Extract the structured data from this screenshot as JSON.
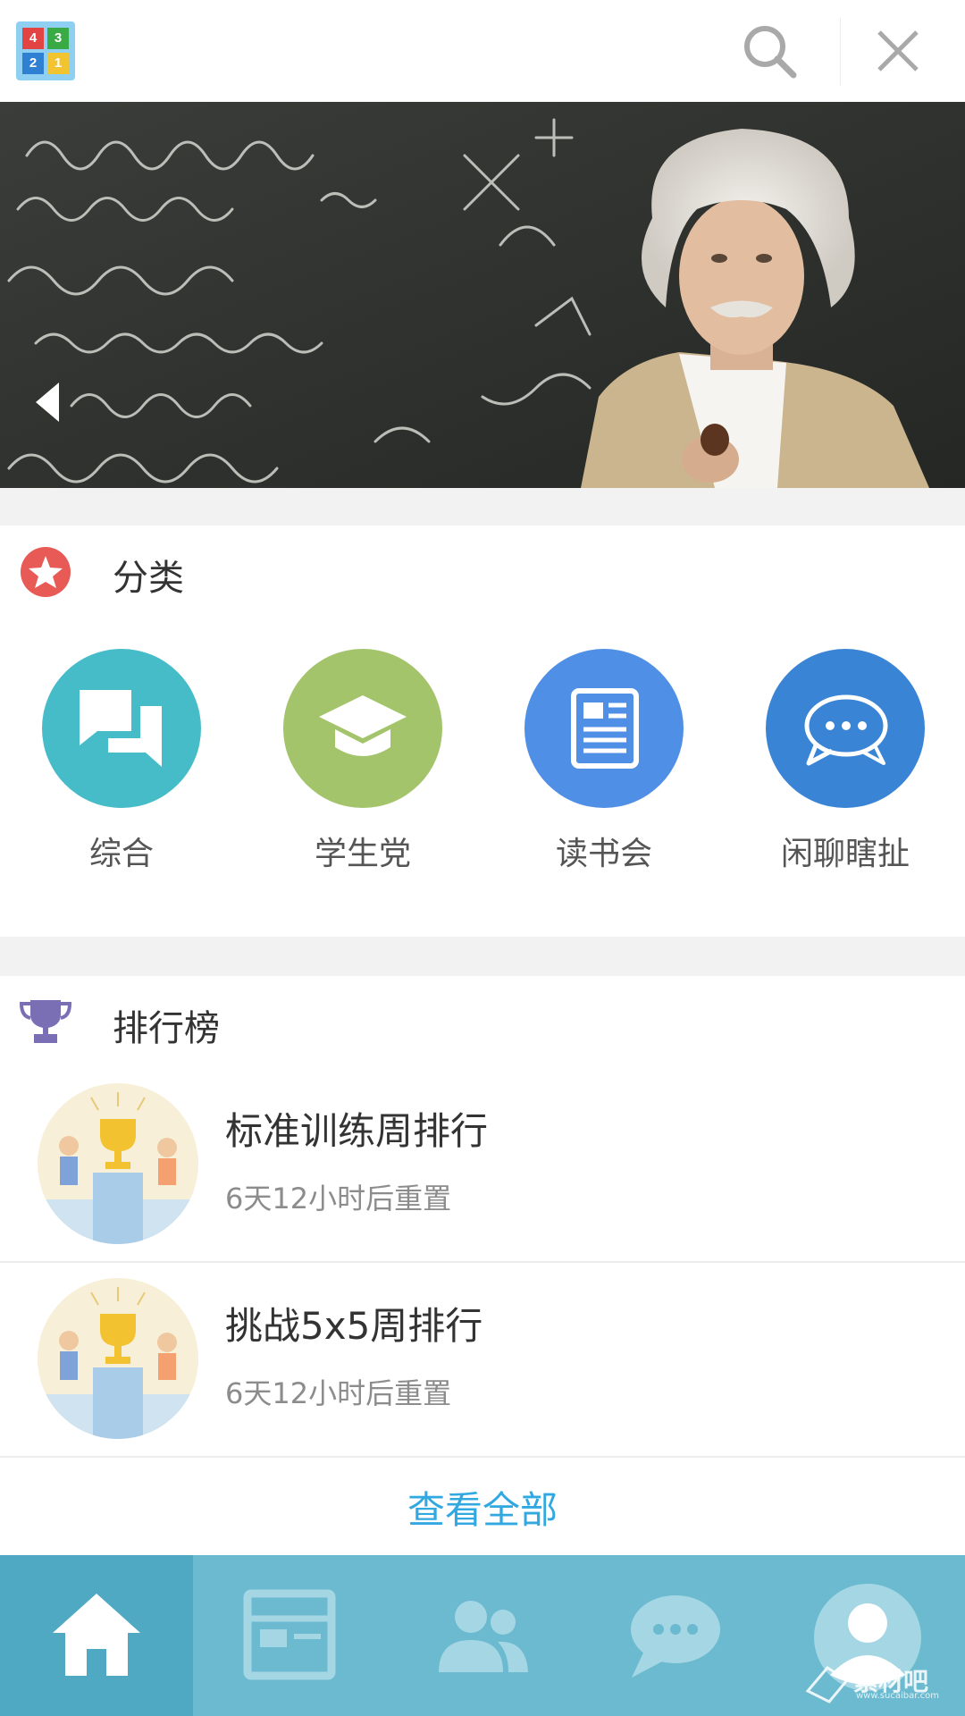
{
  "app": {
    "logo_tiles": [
      "4",
      "3",
      "2",
      "1"
    ]
  },
  "categories": {
    "title": "分类",
    "items": [
      {
        "label": "综合",
        "color": "#46bcc8",
        "icon": "chat-bubbles-icon"
      },
      {
        "label": "学生党",
        "color": "#a3c46a",
        "icon": "graduation-cap-icon"
      },
      {
        "label": "读书会",
        "color": "#4f8fe6",
        "icon": "newspaper-icon"
      },
      {
        "label": "闲聊瞎扯",
        "color": "#3a84d6",
        "icon": "speech-bubble-dots-icon"
      }
    ]
  },
  "ranking": {
    "title": "排行榜",
    "items": [
      {
        "title": "标准训练周排行",
        "subtitle": "6天12小时后重置"
      },
      {
        "title": "挑战5x5周排行",
        "subtitle": "6天12小时后重置"
      }
    ],
    "view_all": "查看全部"
  },
  "tabbar": {
    "items": [
      {
        "name": "home-icon",
        "active": true
      },
      {
        "name": "news-icon",
        "active": false
      },
      {
        "name": "friends-icon",
        "active": false
      },
      {
        "name": "messages-icon",
        "active": false
      },
      {
        "name": "profile-icon",
        "active": false
      }
    ]
  },
  "watermark": {
    "text": "素材吧",
    "url": "www.sucaibar.com"
  },
  "colors": {
    "accent": "#31a8e0",
    "tabbar": "#6bbad0",
    "tabbar_active": "#4fa9c2"
  }
}
